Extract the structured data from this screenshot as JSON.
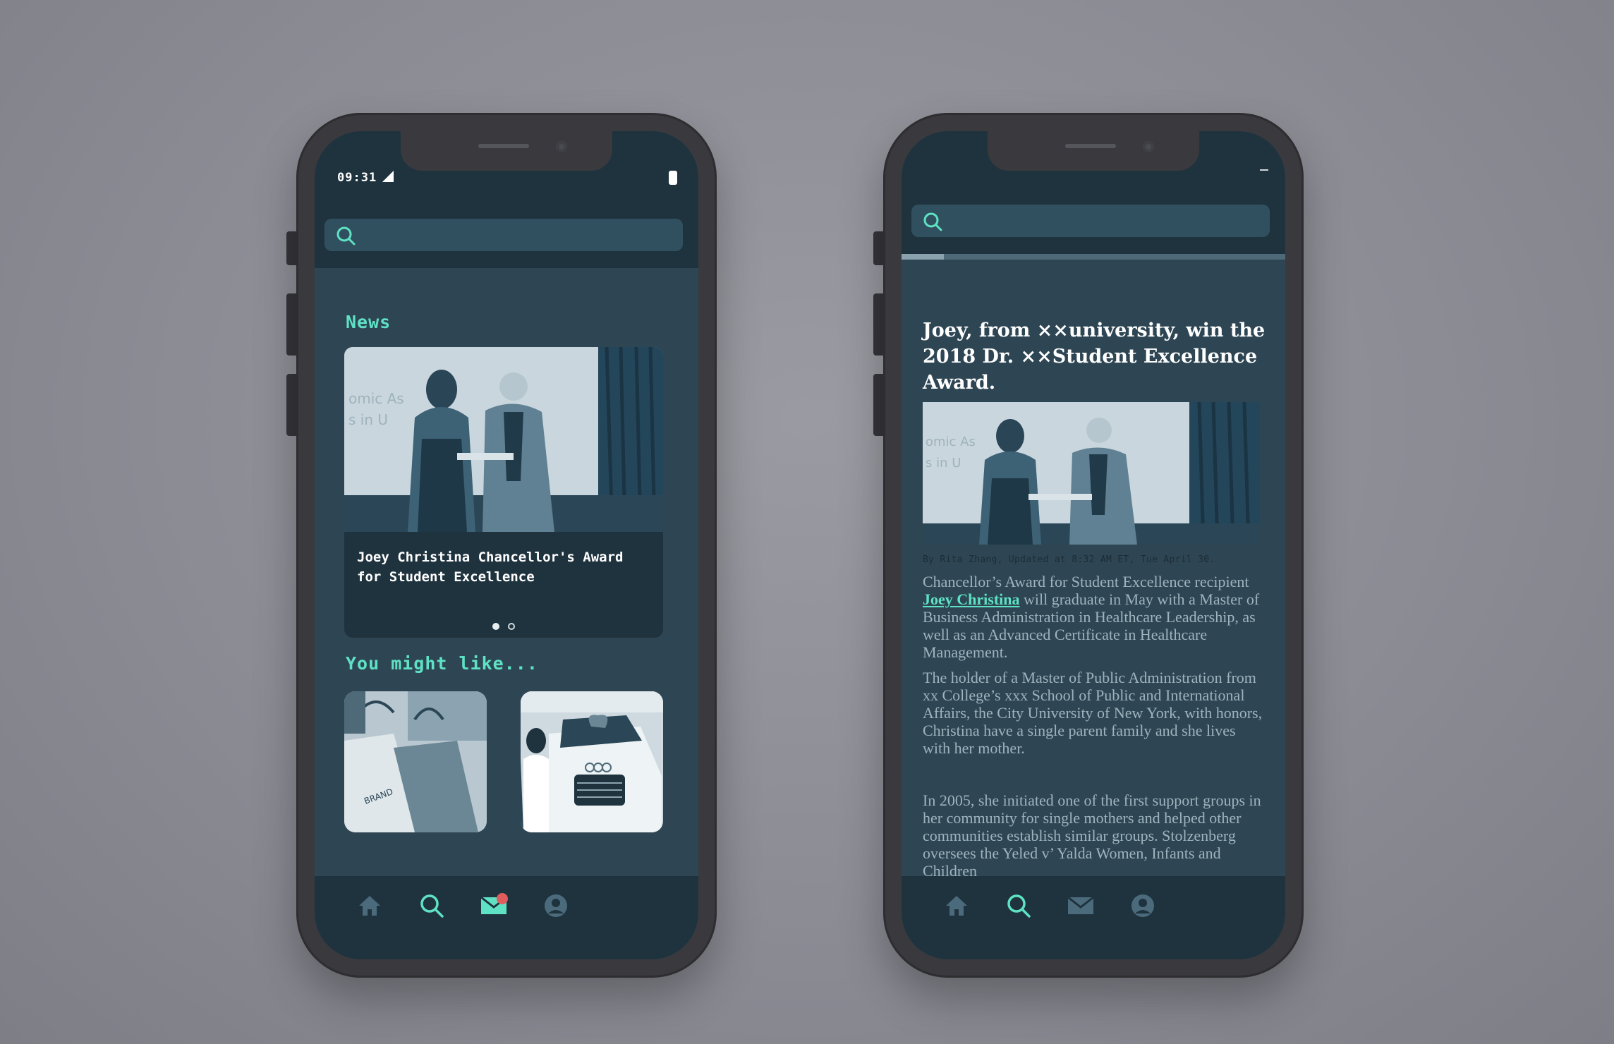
{
  "colors": {
    "accent": "#5fe2c4",
    "badge": "#e15d5d",
    "background": "#2e4654",
    "bar": "#1f333e"
  },
  "left_phone": {
    "status": {
      "time": "09:31"
    },
    "search": {
      "placeholder": "",
      "icon": "search-icon"
    },
    "news": {
      "title": "News",
      "card": {
        "headline": "Joey Christina Chancellor's Award for Student Excellence"
      },
      "carousel": {
        "count": 2,
        "active": 0
      }
    },
    "recommend": {
      "title": "You might like..."
    },
    "tabs": [
      {
        "icon": "home-icon",
        "active": false
      },
      {
        "icon": "search-icon",
        "active": false
      },
      {
        "icon": "mail-icon",
        "active": true,
        "badge": true
      },
      {
        "icon": "profile-icon",
        "active": false
      }
    ]
  },
  "right_phone": {
    "search": {
      "placeholder": "",
      "icon": "search-icon"
    },
    "reading_progress": 0.11,
    "article": {
      "title": "Joey, from ××university, win the 2018 Dr. ××Student Excellence Award.",
      "byline": "By Rita Zhang, Updated at 8:32 AM ET, Tue April 30.",
      "p1_before": "Chancellor’s Award for Student Excellence recipient ",
      "p1_link": "Joey Christina",
      "p1_after": " will graduate in May with a Master of Business Administration in Healthcare Leadership, as well as an Advanced Certificate in Healthcare Management.",
      "p2": "The holder of a Master of Public Administration from xx College’s xxx School of Public and International Affairs, the City University of New York, with honors, Christina have a single parent family and she lives with her mother.",
      "p3": "In 2005, she initiated one of the first support groups in her community for single mothers and helped other communities establish similar groups. Stolzenberg oversees the Yeled v’ Yalda Women, Infants and Children"
    },
    "tabs": [
      {
        "icon": "home-icon",
        "active": false
      },
      {
        "icon": "search-icon",
        "active": true
      },
      {
        "icon": "mail-icon",
        "active": false
      },
      {
        "icon": "profile-icon",
        "active": false
      }
    ]
  }
}
